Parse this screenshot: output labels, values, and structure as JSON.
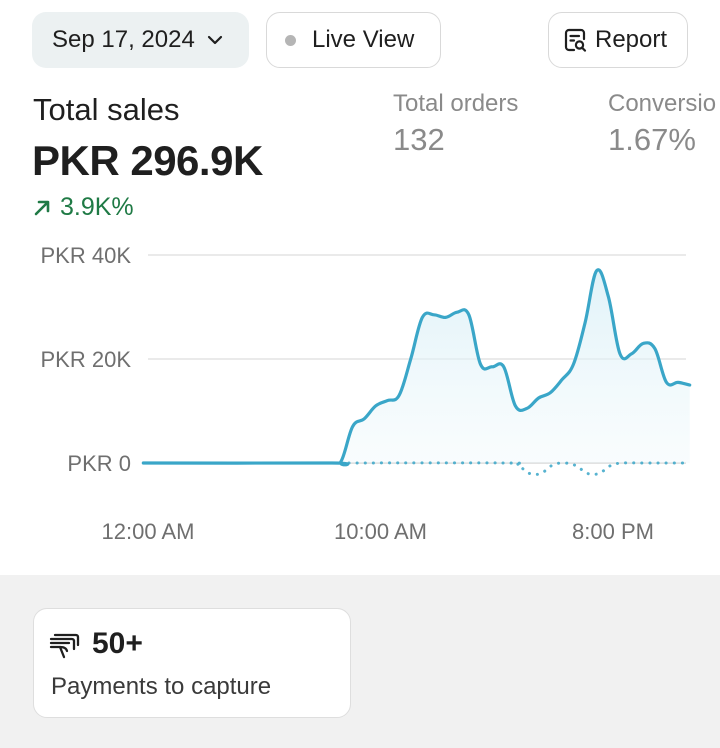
{
  "toolbar": {
    "date_label": "Sep 17, 2024",
    "live_view_label": "Live View",
    "report_label": "Report"
  },
  "metrics": {
    "total_sales_label": "Total sales",
    "total_sales_value": "PKR 296.9K",
    "total_sales_change": "3.9K%",
    "total_orders_label": "Total orders",
    "total_orders_value": "132",
    "conversion_label": "Conversio",
    "conversion_value": "1.67%"
  },
  "chart_data": {
    "type": "line",
    "y_tick_labels": [
      "PKR 40K",
      "PKR 20K",
      "PKR 0"
    ],
    "y_ticks": [
      40000,
      20000,
      0
    ],
    "x_tick_labels": [
      "12:00 AM",
      "10:00 AM",
      "8:00 PM"
    ],
    "x_ticks": [
      0,
      10,
      20
    ],
    "ylim": [
      0,
      40000
    ],
    "xlim": [
      -0.2,
      23.3
    ],
    "grid": true,
    "legend": "none",
    "series": [
      {
        "style": "solid",
        "color": "#3aa6c8",
        "x": [
          -0.2,
          7.8,
          8.3,
          8.8,
          9.3,
          9.8,
          10.3,
          10.8,
          11.3,
          11.8,
          12.3,
          12.8,
          13.3,
          13.8,
          14.3,
          14.8,
          15.3,
          15.8,
          16.3,
          16.8,
          17.3,
          17.8,
          18.3,
          18.8,
          19.3,
          19.8,
          20.3,
          20.8,
          21.3,
          21.8,
          22.3,
          22.8,
          23.3
        ],
        "y": [
          0,
          0,
          300,
          7000,
          8500,
          11000,
          12000,
          13000,
          20000,
          28000,
          28500,
          28000,
          29000,
          28500,
          19000,
          18500,
          18500,
          11000,
          10500,
          12500,
          13500,
          16000,
          19000,
          27000,
          37000,
          32000,
          21000,
          21000,
          23000,
          22000,
          15500,
          15500,
          15000
        ]
      },
      {
        "style": "dotted",
        "color": "#3aa6c8",
        "x": [
          8.3,
          15.4,
          15.9,
          16.4,
          16.9,
          17.4,
          17.9,
          18.4,
          18.9,
          19.4,
          19.9,
          20.4,
          21.4,
          22.4,
          23.3
        ],
        "y": [
          0,
          0,
          -400,
          -2000,
          -2000,
          -400,
          0,
          -500,
          -2000,
          -2000,
          -500,
          0,
          0,
          0,
          0
        ]
      }
    ]
  },
  "card": {
    "value": "50+",
    "label": "Payments to capture"
  }
}
